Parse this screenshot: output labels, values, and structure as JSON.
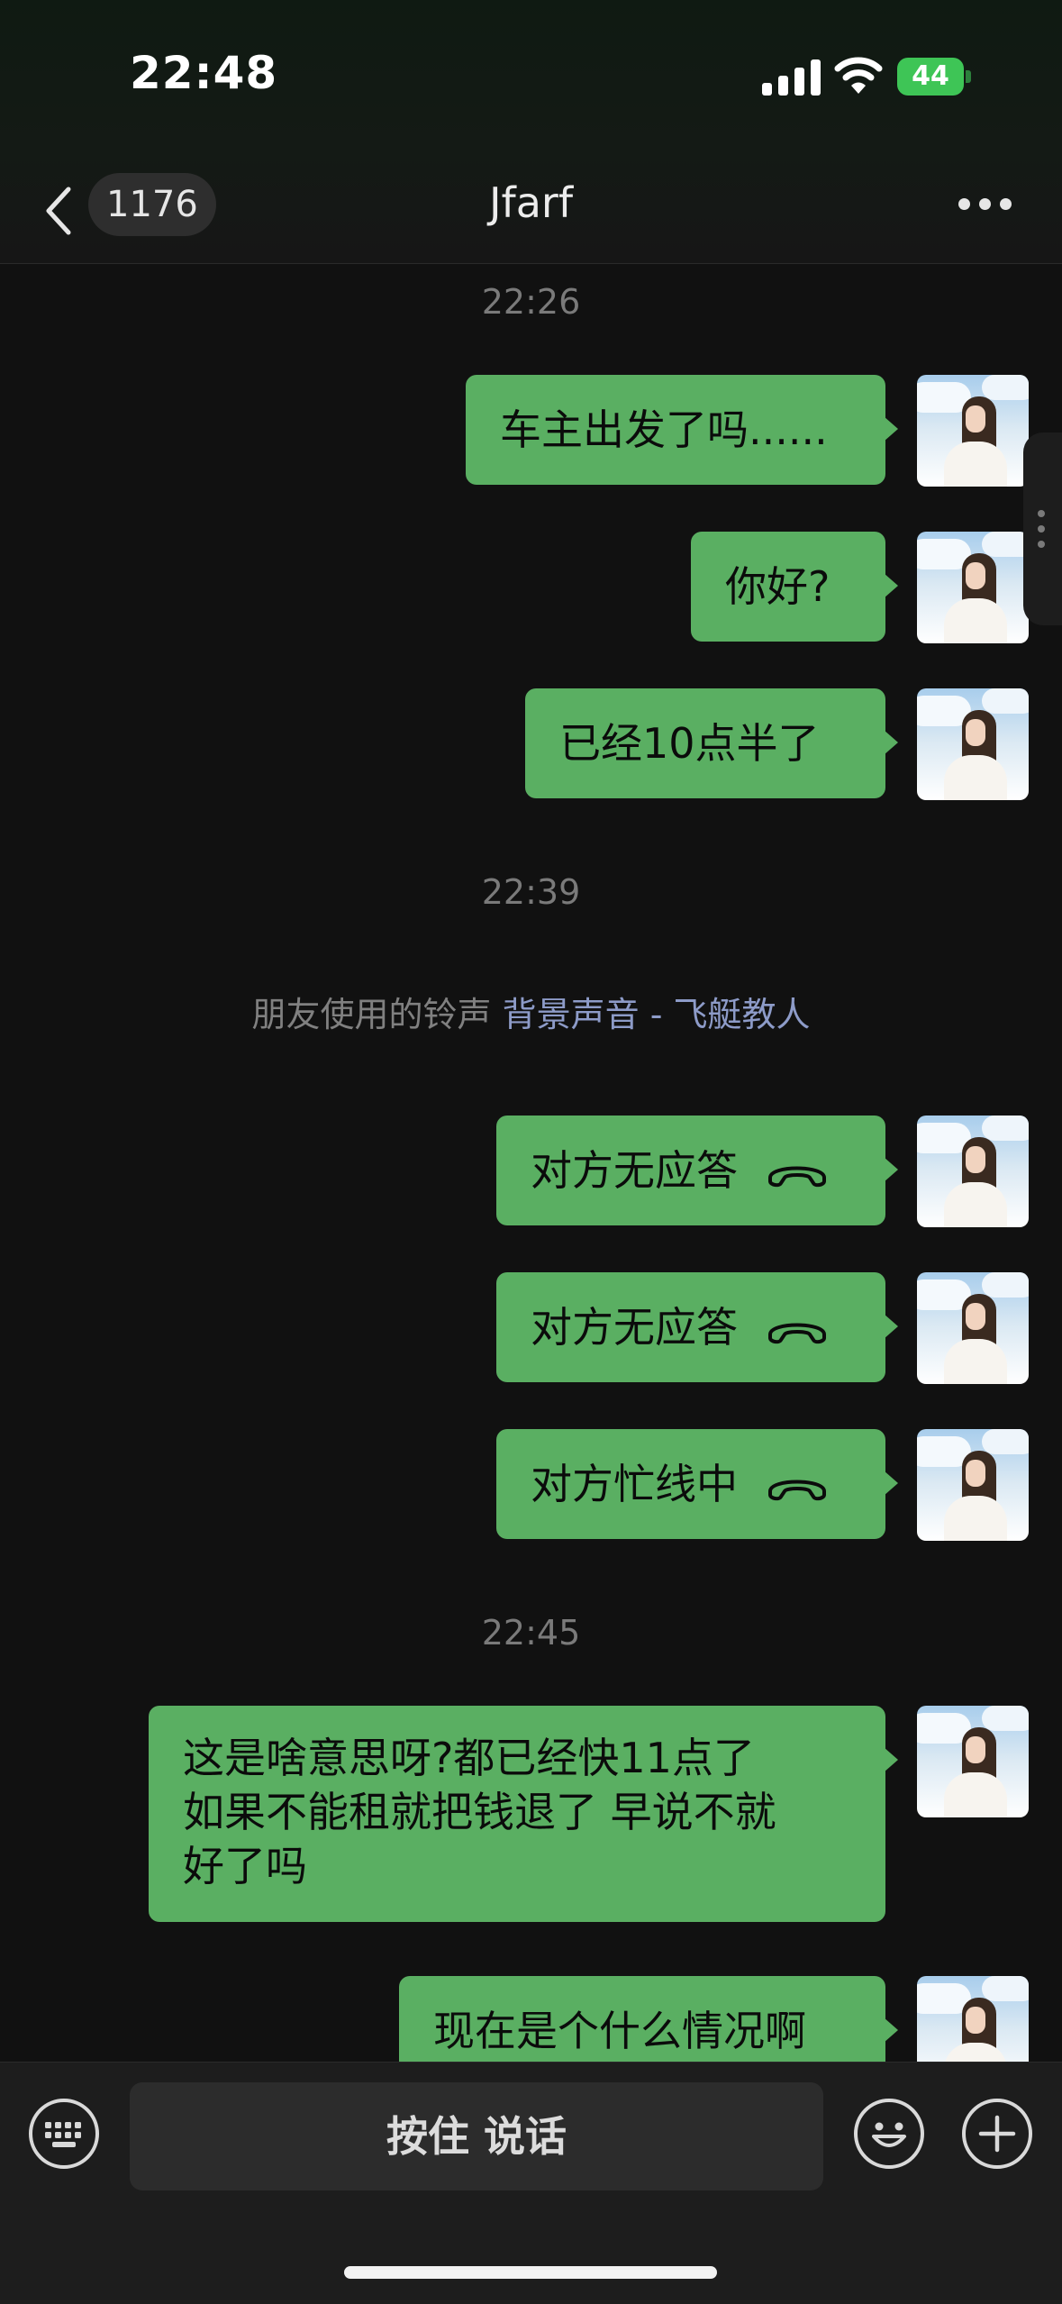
{
  "status_bar": {
    "time": "22:48",
    "battery": "44"
  },
  "header": {
    "back_count": "1176",
    "title": "Jfarf"
  },
  "messages": [
    {
      "type": "time",
      "text": "22:26"
    },
    {
      "type": "sent",
      "text": "车主出发了吗......"
    },
    {
      "type": "sent",
      "text": "你好?"
    },
    {
      "type": "sent",
      "text": "已经10点半了"
    },
    {
      "type": "time",
      "text": "22:39"
    },
    {
      "type": "system",
      "prefix": "朋友使用的铃声",
      "link": "背景声音 - 飞艇教人"
    },
    {
      "type": "call",
      "text": "对方无应答"
    },
    {
      "type": "call",
      "text": "对方无应答"
    },
    {
      "type": "call",
      "text": "对方忙线中"
    },
    {
      "type": "time",
      "text": "22:45"
    },
    {
      "type": "sent",
      "lines": [
        "这是啥意思呀?都已经快11点了",
        "如果不能租就把钱退了 早说不就",
        "好了吗"
      ]
    },
    {
      "type": "sent",
      "text": "现在是个什么情况啊"
    }
  ],
  "input_bar": {
    "voice_label": "按住 说话"
  },
  "icons": {
    "back": "chevron-left-icon",
    "more": "more-dots-icon",
    "call": "hang-up-icon",
    "keyboard": "keyboard-icon",
    "emoji": "emoji-icon",
    "add": "plus-icon"
  },
  "colors": {
    "bubble": "#5aaf62",
    "background": "#111111",
    "link": "#8d9bc8"
  }
}
